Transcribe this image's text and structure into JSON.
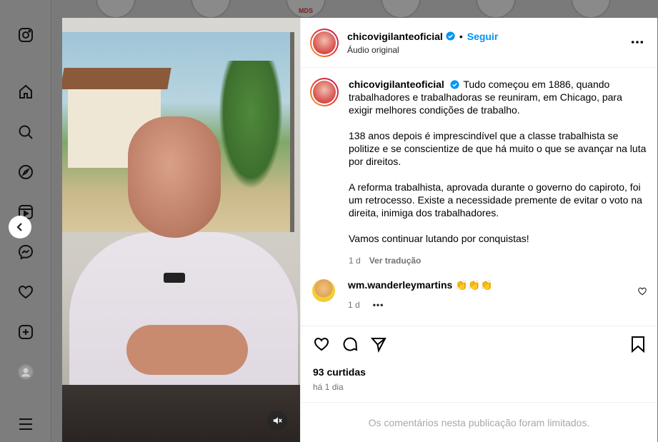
{
  "post": {
    "username": "chicovigilanteoficial",
    "follow_label": "Seguir",
    "separator": "•",
    "audio": "Áudio original",
    "caption": [
      "Tudo começou em 1886, quando trabalhadores e trabalhadoras se reuniram, em Chicago, para exigir melhores condições de trabalho.",
      "138 anos depois é imprescindível que a classe trabalhista se politize e se conscientize de que há muito o que se avançar na luta por direitos.",
      "A reforma trabalhista, aprovada durante o governo do capiroto, foi um retrocesso. Existe a necessidade premente de evitar o voto na direita, inimiga dos trabalhadores.",
      "Vamos continuar lutando por conquistas!"
    ],
    "caption_age": "1 d",
    "translate_label": "Ver tradução",
    "likes": "93 curtidas",
    "posted": "há 1 dia",
    "comments_limited": "Os comentários nesta publicação foram limitados."
  },
  "comment": {
    "username": "wm.wanderleymartins",
    "text": "👏👏👏",
    "age": "1 d",
    "more": "•••"
  },
  "background": {
    "story_mark": "MDS"
  },
  "colors": {
    "accent": "#0095f6",
    "muted": "#737373"
  }
}
